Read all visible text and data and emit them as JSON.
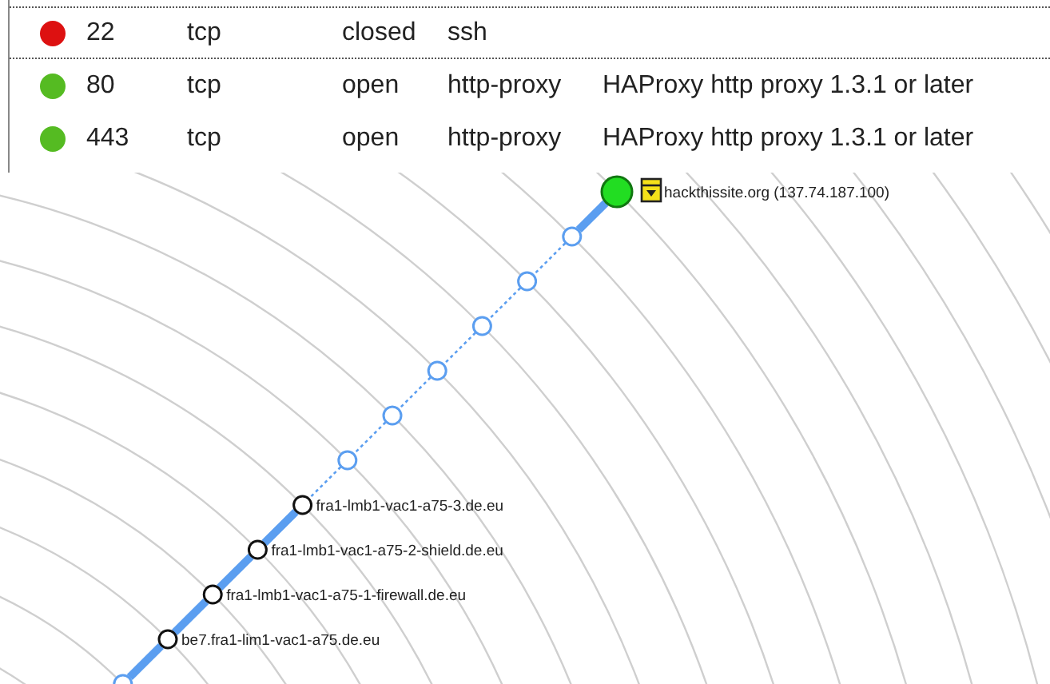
{
  "ports": [
    {
      "color": "#dd1111",
      "port": "22",
      "protocol": "tcp",
      "state": "closed",
      "service": "ssh",
      "focused": true
    },
    {
      "color": "#55bb22",
      "port": "80",
      "protocol": "tcp",
      "state": "open",
      "service": "http-proxy",
      "version": "HAProxy http proxy 1.3.1 or later",
      "focused": false
    },
    {
      "color": "#55bb22",
      "port": "443",
      "protocol": "tcp",
      "state": "open",
      "service": "http-proxy",
      "version": "HAProxy http proxy 1.3.1 or later",
      "focused": false
    }
  ],
  "topology": {
    "nodes": [
      {
        "kind": "target",
        "label": "hackthissite.org (137.74.187.100)"
      },
      {
        "kind": "unnamed"
      },
      {
        "kind": "unnamed"
      },
      {
        "kind": "unnamed"
      },
      {
        "kind": "unnamed"
      },
      {
        "kind": "unnamed"
      },
      {
        "kind": "unnamed"
      },
      {
        "kind": "named",
        "label": "fra1-lmb1-vac1-a75-3.de.eu"
      },
      {
        "kind": "named",
        "label": "fra1-lmb1-vac1-a75-2-shield.de.eu"
      },
      {
        "kind": "named",
        "label": "fra1-lmb1-vac1-a75-1-firewall.de.eu"
      },
      {
        "kind": "named",
        "label": "be7.fra1-lim1-vac1-a75.de.eu"
      },
      {
        "kind": "unnamed"
      }
    ],
    "links": [
      {
        "dashed": false
      },
      {
        "dashed": true
      },
      {
        "dashed": true
      },
      {
        "dashed": true
      },
      {
        "dashed": true
      },
      {
        "dashed": true
      },
      {
        "dashed": true
      },
      {
        "dashed": false
      },
      {
        "dashed": false
      },
      {
        "dashed": false
      },
      {
        "dashed": false
      }
    ]
  }
}
